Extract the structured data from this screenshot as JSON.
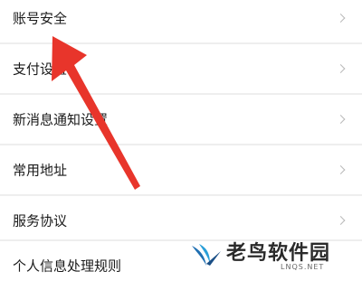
{
  "settings_list": {
    "items": [
      {
        "label": "账号安全"
      },
      {
        "label": "支付设置"
      },
      {
        "label": "新消息通知设置"
      },
      {
        "label": "常用地址"
      },
      {
        "label": "服务协议"
      },
      {
        "label": "个人信息处理规则"
      }
    ]
  },
  "watermark": {
    "brand": "老鸟软件园",
    "domain": "LNQS.NET"
  },
  "colors": {
    "arrow": "#e8352b",
    "row_bg": "#ffffff",
    "divider": "#eeeeee"
  }
}
